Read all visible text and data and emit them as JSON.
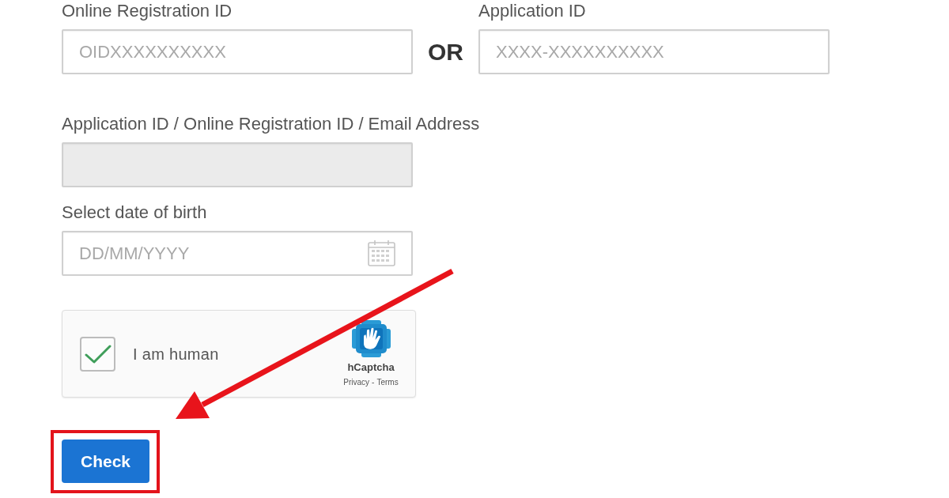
{
  "id_fields": [
    {
      "label": "Online Registration ID",
      "placeholder": "OIDXXXXXXXXXX",
      "disabled": false
    },
    {
      "label": "Application ID",
      "placeholder": "XXXX-XXXXXXXXXX",
      "disabled": false
    }
  ],
  "separator": "OR",
  "fields": [
    {
      "kind": "text",
      "label": "Application ID / Online Registration ID / Email Address",
      "disabled": true
    },
    {
      "kind": "date",
      "label": "Select date of birth",
      "placeholder": "DD/MM/YYYY",
      "disabled": false
    }
  ],
  "captcha": {
    "label": "I am human",
    "checked": true,
    "brand": "hCaptcha",
    "links": [
      "Privacy",
      "Terms"
    ],
    "link_separator": "-"
  },
  "submit": {
    "label": "Check",
    "highlighted": true
  },
  "pointer_arrow": true
}
